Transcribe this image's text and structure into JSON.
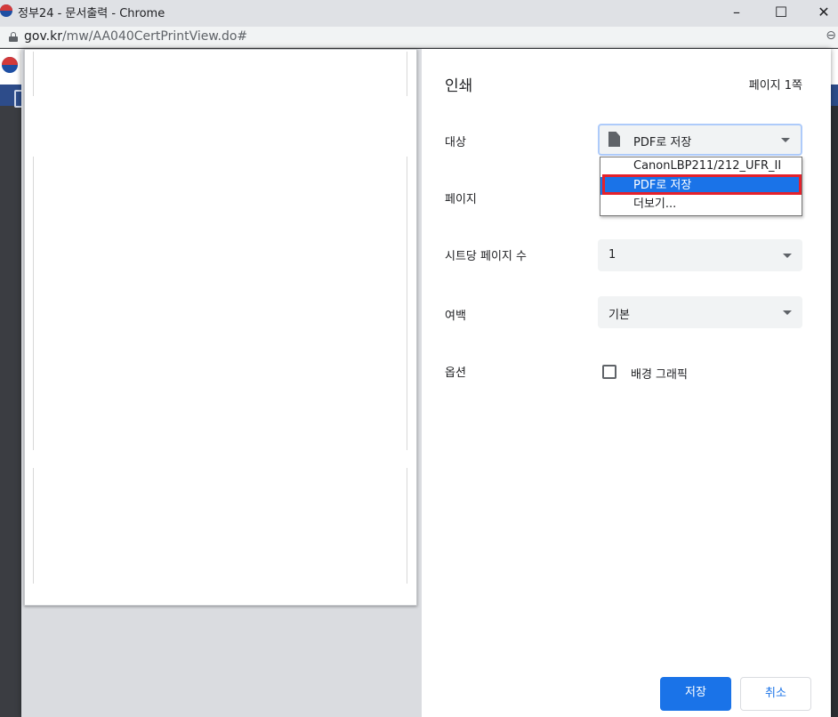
{
  "window": {
    "title": "정부24 - 문서출력 - Chrome",
    "minimize": "–",
    "maximize": "☐",
    "close": "✕"
  },
  "address": {
    "host": "gov.kr",
    "path": "/mw/AA040CertPrintView.do#"
  },
  "print": {
    "title": "인쇄",
    "page_count": "페이지 1쪽",
    "destination": {
      "label": "대상",
      "value": "PDF로 저장",
      "options": [
        "CanonLBP211/212_UFR_II",
        "PDF로 저장",
        "더보기..."
      ]
    },
    "pages": {
      "label": "페이지"
    },
    "pages_per_sheet": {
      "label": "시트당 페이지 수",
      "value": "1"
    },
    "margins": {
      "label": "여백",
      "value": "기본"
    },
    "options": {
      "label": "옵션",
      "background_graphics": "배경 그래픽"
    },
    "save_button": "저장",
    "cancel_button": "취소"
  }
}
